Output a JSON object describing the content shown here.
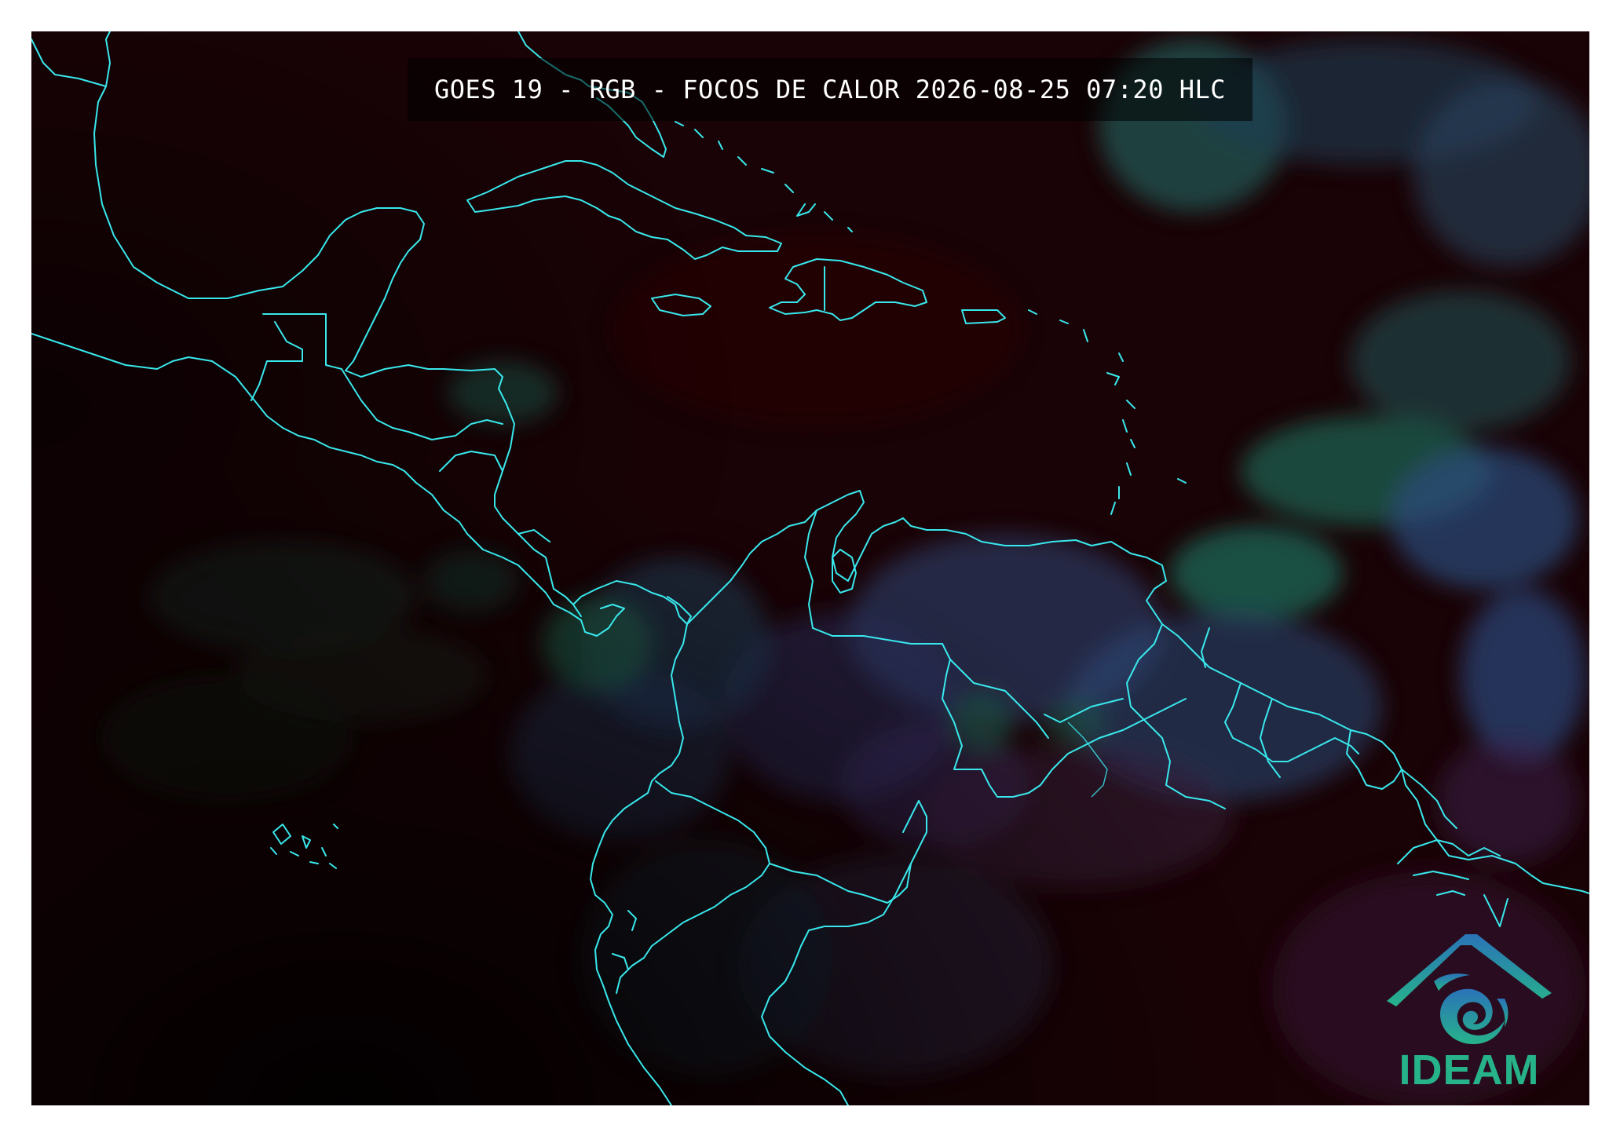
{
  "map": {
    "title": "GOES 19 - RGB - FOCOS DE CALOR 2026-08-25 07:20 HLC",
    "colors": {
      "background": "#1a0306",
      "boundary": "#38e8ec",
      "cloud_blue": "#2e4c7a",
      "cloud_green": "#1f5a4c",
      "land_dark": "#1b0f1a"
    }
  },
  "logo": {
    "text": "IDEAM",
    "icon": "ideam-swirl-roof-icon",
    "color": "#27b38a"
  }
}
